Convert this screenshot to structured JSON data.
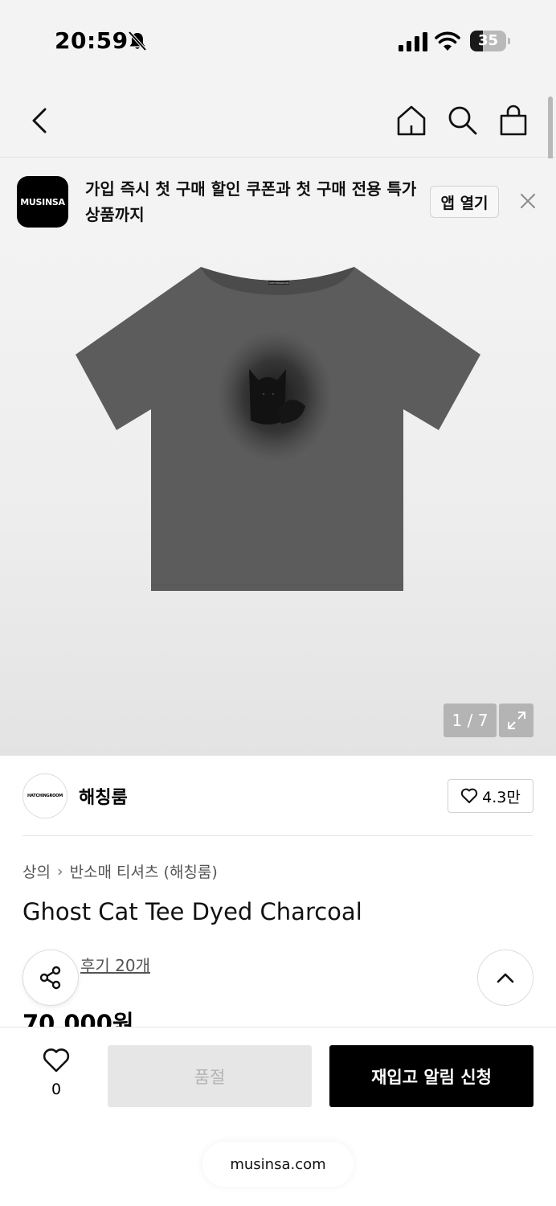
{
  "status_bar": {
    "time": "20:59",
    "battery_level": "35",
    "battery_fraction": 0.35
  },
  "nav": {
    "icons": [
      "back-icon",
      "home-icon",
      "search-icon",
      "cart-icon"
    ]
  },
  "app_banner": {
    "logo_text": "MUSINSA",
    "message": "가입 즉시 첫 구매 할인 쿠폰과 첫 구매 전용 특가 상품까지",
    "open_label": "앱 열기"
  },
  "gallery": {
    "counter": "1 / 7",
    "tee_print": "HATCHINGROOM"
  },
  "brand": {
    "logo_text": "HATCHINGROOM",
    "name": "해칭룸",
    "likes": "4.3만"
  },
  "breadcrumb": {
    "category": "상의",
    "subcategory": "반소매 티셔츠 (해칭룸)"
  },
  "product": {
    "title": "Ghost Cat Tee Dyed Charcoal",
    "review_label": "후기 20개",
    "price": "70,000원"
  },
  "bottom_bar": {
    "wish_count": "0",
    "soldout_label": "품절",
    "restock_label": "재입고 알림 신청",
    "url": "musinsa.com"
  },
  "colors": {
    "accent": "#000000",
    "tee": "#5d5d5d",
    "disabled": "#e6e6e6"
  }
}
